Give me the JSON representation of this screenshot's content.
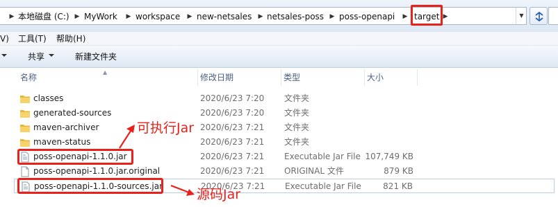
{
  "address": {
    "crumbs": [
      "本地磁盘 (C:)",
      "MyWork",
      "workspace",
      "new-netsales",
      "netsales-poss",
      "poss-openapi",
      "target"
    ]
  },
  "menu": {
    "items": [
      "V)",
      "工具(T)",
      "帮助(H)"
    ]
  },
  "toolbar": {
    "share_label": "共享",
    "new_folder_label": "新建文件夹"
  },
  "columns": {
    "name": "名称",
    "date": "修改日期",
    "type": "类型",
    "size": "大小"
  },
  "files": [
    {
      "name": "classes",
      "date": "2020/6/23 7:20",
      "type": "文件夹",
      "size": "",
      "icon": "folder-icon"
    },
    {
      "name": "generated-sources",
      "date": "2020/6/23 7:20",
      "type": "文件夹",
      "size": "",
      "icon": "folder-icon"
    },
    {
      "name": "maven-archiver",
      "date": "2020/6/23 7:21",
      "type": "文件夹",
      "size": "",
      "icon": "folder-icon"
    },
    {
      "name": "maven-status",
      "date": "2020/6/23 7:21",
      "type": "文件夹",
      "size": "",
      "icon": "folder-icon"
    },
    {
      "name": "poss-openapi-1.1.0.jar",
      "date": "2020/6/23 7:21",
      "type": "Executable Jar File",
      "size": "107,749 KB",
      "icon": "jar-file-icon"
    },
    {
      "name": "poss-openapi-1.1.0.jar.original",
      "date": "2020/6/23 7:21",
      "type": "ORIGINAL 文件",
      "size": "879 KB",
      "icon": "file-icon"
    },
    {
      "name": "poss-openapi-1.1.0-sources.jar",
      "date": "2020/6/23 7:21",
      "type": "Executable Jar File",
      "size": "821 KB",
      "icon": "jar-file-icon"
    }
  ],
  "annotations": {
    "executable_jar": "可执行Jar",
    "source_jar": "源码Jar"
  },
  "colors": {
    "annotation_red": "#e8221b",
    "folder_yellow": "#f2c94c"
  }
}
